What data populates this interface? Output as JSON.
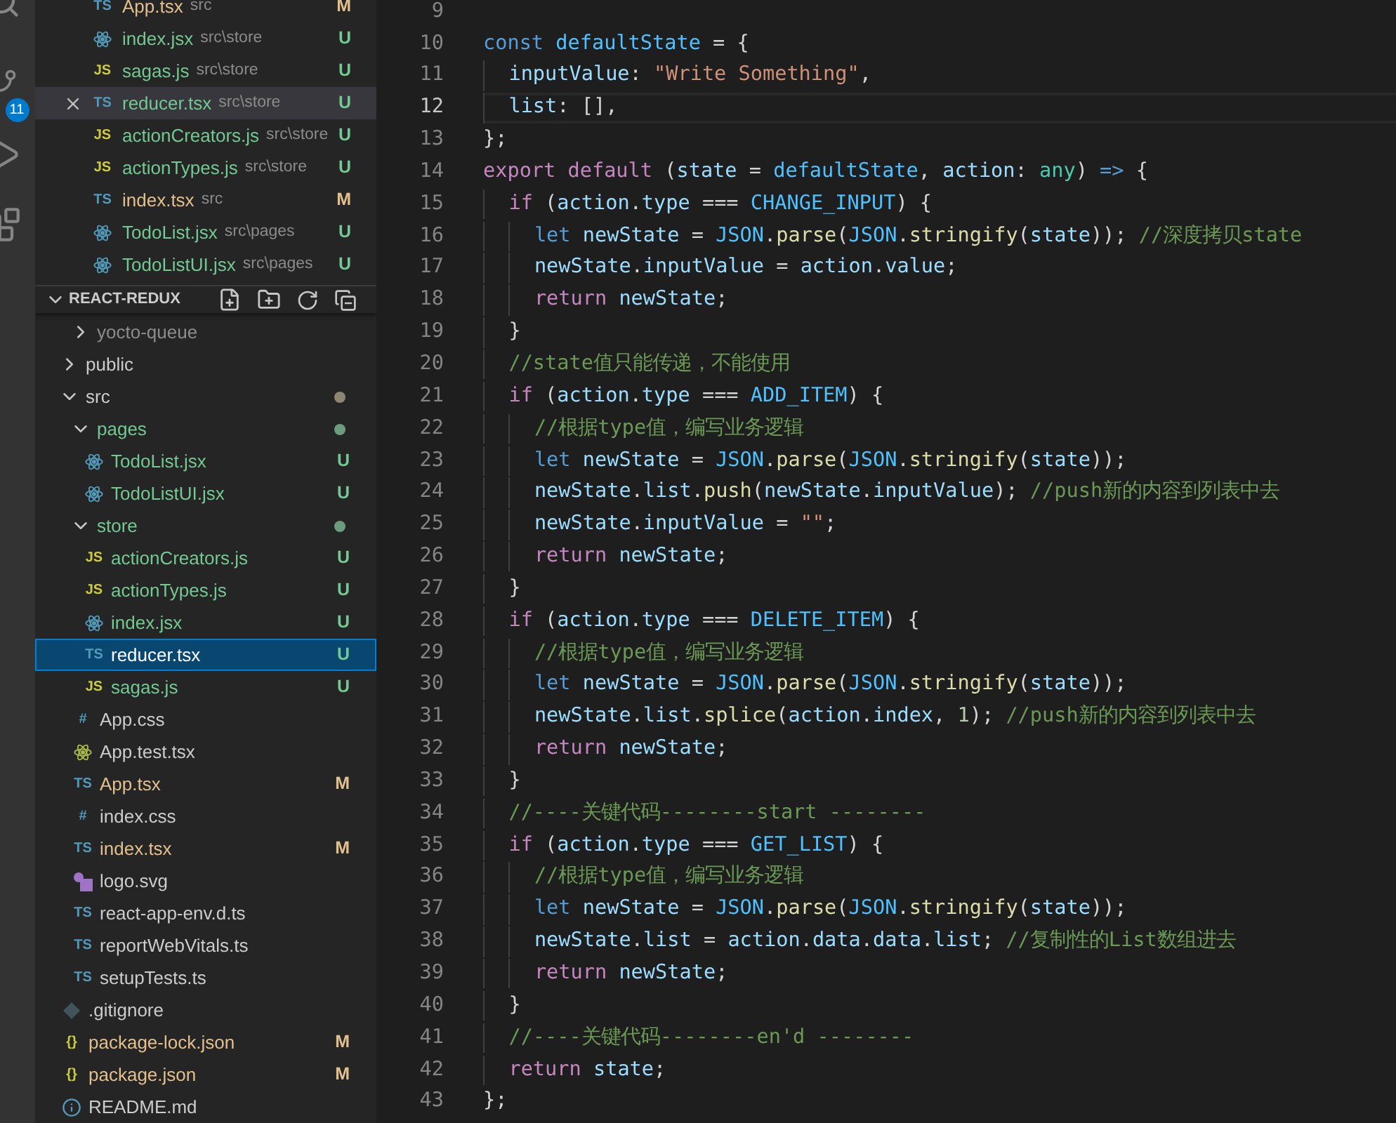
{
  "activity_bar": {
    "source_control_badge": "11"
  },
  "open_editors": [
    {
      "name": "App.tsx",
      "path": "src",
      "status": "M",
      "selected": false,
      "icon": {
        "kind": "glyph",
        "text": "TS",
        "color": "#519aba"
      }
    },
    {
      "name": "index.jsx",
      "path": "src\\store",
      "status": "U",
      "selected": false,
      "icon": {
        "kind": "react",
        "color": "#519aba"
      }
    },
    {
      "name": "sagas.js",
      "path": "src\\store",
      "status": "U",
      "selected": false,
      "icon": {
        "kind": "glyph",
        "text": "JS",
        "color": "#cbcb41"
      }
    },
    {
      "name": "reducer.tsx",
      "path": "src\\store",
      "status": "U",
      "selected": true,
      "icon": {
        "kind": "glyph",
        "text": "TS",
        "color": "#519aba"
      }
    },
    {
      "name": "actionCreators.js",
      "path": "src\\store",
      "status": "U",
      "selected": false,
      "icon": {
        "kind": "glyph",
        "text": "JS",
        "color": "#cbcb41"
      }
    },
    {
      "name": "actionTypes.js",
      "path": "src\\store",
      "status": "U",
      "selected": false,
      "icon": {
        "kind": "glyph",
        "text": "JS",
        "color": "#cbcb41"
      }
    },
    {
      "name": "index.tsx",
      "path": "src",
      "status": "M",
      "selected": false,
      "icon": {
        "kind": "glyph",
        "text": "TS",
        "color": "#519aba"
      }
    },
    {
      "name": "TodoList.jsx",
      "path": "src\\pages",
      "status": "U",
      "selected": false,
      "icon": {
        "kind": "react",
        "color": "#519aba"
      }
    },
    {
      "name": "TodoListUI.jsx",
      "path": "src\\pages",
      "status": "U",
      "selected": false,
      "icon": {
        "kind": "react",
        "color": "#519aba"
      }
    }
  ],
  "explorer": {
    "title": "REACT-REDUX",
    "expanded": true,
    "partial_above": [
      {
        "kind": "folder",
        "name": "yocto-queue",
        "expanded": false,
        "ignored": true,
        "has_changes": false
      }
    ],
    "tree": [
      {
        "kind": "folder",
        "name": "public",
        "expanded": false,
        "ignored": false,
        "untracked": false,
        "has_changes": false
      },
      {
        "kind": "folder",
        "name": "src",
        "expanded": true,
        "ignored": false,
        "untracked": false,
        "has_changes": true,
        "children": [
          {
            "kind": "folder",
            "name": "pages",
            "expanded": true,
            "ignored": false,
            "untracked": true,
            "has_changes": true,
            "children": [
              {
                "kind": "file",
                "name": "TodoList.jsx",
                "status": "U",
                "selected": false,
                "icon": {
                  "kind": "react",
                  "color": "#519aba"
                }
              },
              {
                "kind": "file",
                "name": "TodoListUI.jsx",
                "status": "U",
                "selected": false,
                "icon": {
                  "kind": "react",
                  "color": "#519aba"
                }
              }
            ]
          },
          {
            "kind": "folder",
            "name": "store",
            "expanded": true,
            "ignored": false,
            "untracked": true,
            "has_changes": true,
            "children": [
              {
                "kind": "file",
                "name": "actionCreators.js",
                "status": "U",
                "selected": false,
                "icon": {
                  "kind": "glyph",
                  "text": "JS",
                  "color": "#cbcb41"
                }
              },
              {
                "kind": "file",
                "name": "actionTypes.js",
                "status": "U",
                "selected": false,
                "icon": {
                  "kind": "glyph",
                  "text": "JS",
                  "color": "#cbcb41"
                }
              },
              {
                "kind": "file",
                "name": "index.jsx",
                "status": "U",
                "selected": false,
                "icon": {
                  "kind": "react",
                  "color": "#519aba"
                }
              },
              {
                "kind": "file",
                "name": "reducer.tsx",
                "status": "U",
                "selected": true,
                "icon": {
                  "kind": "glyph",
                  "text": "TS",
                  "color": "#519aba"
                }
              },
              {
                "kind": "file",
                "name": "sagas.js",
                "status": "U",
                "selected": false,
                "icon": {
                  "kind": "glyph",
                  "text": "JS",
                  "color": "#cbcb41"
                }
              }
            ]
          },
          {
            "kind": "file",
            "name": "App.css",
            "selected": false,
            "icon": {
              "kind": "glyph",
              "text": "#",
              "color": "#519aba"
            }
          },
          {
            "kind": "file",
            "name": "App.test.tsx",
            "selected": false,
            "icon": {
              "kind": "react",
              "color": "#a8b84a"
            }
          },
          {
            "kind": "file",
            "name": "App.tsx",
            "status": "M",
            "selected": false,
            "icon": {
              "kind": "glyph",
              "text": "TS",
              "color": "#519aba"
            }
          },
          {
            "kind": "file",
            "name": "index.css",
            "selected": false,
            "icon": {
              "kind": "glyph",
              "text": "#",
              "color": "#519aba"
            }
          },
          {
            "kind": "file",
            "name": "index.tsx",
            "status": "M",
            "selected": false,
            "icon": {
              "kind": "glyph",
              "text": "TS",
              "color": "#519aba"
            }
          },
          {
            "kind": "file",
            "name": "logo.svg",
            "selected": false,
            "icon": {
              "kind": "shapes",
              "color": "#a074c4"
            }
          },
          {
            "kind": "file",
            "name": "react-app-env.d.ts",
            "selected": false,
            "icon": {
              "kind": "glyph",
              "text": "TS",
              "color": "#519aba"
            }
          },
          {
            "kind": "file",
            "name": "reportWebVitals.ts",
            "selected": false,
            "icon": {
              "kind": "glyph",
              "text": "TS",
              "color": "#519aba"
            }
          },
          {
            "kind": "file",
            "name": "setupTests.ts",
            "selected": false,
            "icon": {
              "kind": "glyph",
              "text": "TS",
              "color": "#519aba"
            }
          }
        ]
      },
      {
        "kind": "file",
        "name": ".gitignore",
        "selected": false,
        "icon": {
          "kind": "diamond",
          "color": "#41535b"
        }
      },
      {
        "kind": "file",
        "name": "package-lock.json",
        "status": "M",
        "selected": false,
        "icon": {
          "kind": "glyph",
          "text": "{}",
          "color": "#cbcb41"
        }
      },
      {
        "kind": "file",
        "name": "package.json",
        "status": "M",
        "selected": false,
        "icon": {
          "kind": "glyph",
          "text": "{}",
          "color": "#cbcb41"
        }
      },
      {
        "kind": "file",
        "name": "README.md",
        "selected": false,
        "icon": {
          "kind": "info",
          "color": "#519aba"
        }
      }
    ]
  },
  "editor": {
    "lines": [
      {
        "number": "9",
        "current": false
      },
      {
        "number": "10",
        "current": false,
        "tokens": [
          {
            "kind": "kw",
            "text": "const "
          },
          {
            "kind": "const",
            "text": "defaultState"
          },
          {
            "kind": "p",
            "text": " = {"
          }
        ]
      },
      {
        "number": "11",
        "current": false,
        "tokens": [
          {
            "kind": "var",
            "text": "  inputValue"
          },
          {
            "kind": "p",
            "text": ": "
          },
          {
            "kind": "str",
            "text": "\"Write Something\""
          },
          {
            "kind": "p",
            "text": ","
          }
        ]
      },
      {
        "number": "12",
        "current": true,
        "tokens": [
          {
            "kind": "var",
            "text": "  list"
          },
          {
            "kind": "p",
            "text": ": [],"
          }
        ]
      },
      {
        "number": "13",
        "current": false,
        "tokens": [
          {
            "kind": "p",
            "text": "};"
          }
        ]
      },
      {
        "number": "14",
        "current": false,
        "tokens": [
          {
            "kind": "ctl",
            "text": "export default"
          },
          {
            "kind": "p",
            "text": " ("
          },
          {
            "kind": "var",
            "text": "state"
          },
          {
            "kind": "p",
            "text": " = "
          },
          {
            "kind": "const",
            "text": "defaultState"
          },
          {
            "kind": "p",
            "text": ", "
          },
          {
            "kind": "var",
            "text": "action"
          },
          {
            "kind": "p",
            "text": ": "
          },
          {
            "kind": "type",
            "text": "any"
          },
          {
            "kind": "p",
            "text": ") "
          },
          {
            "kind": "kw",
            "text": "=>"
          },
          {
            "kind": "p",
            "text": " {"
          }
        ]
      },
      {
        "number": "15",
        "current": false,
        "tokens": [
          {
            "kind": "ctl",
            "text": "  if"
          },
          {
            "kind": "p",
            "text": " ("
          },
          {
            "kind": "var",
            "text": "action"
          },
          {
            "kind": "p",
            "text": "."
          },
          {
            "kind": "var",
            "text": "type"
          },
          {
            "kind": "p",
            "text": " === "
          },
          {
            "kind": "const",
            "text": "CHANGE_INPUT"
          },
          {
            "kind": "p",
            "text": ") {"
          }
        ]
      },
      {
        "number": "16",
        "current": false,
        "tokens": [
          {
            "kind": "kw",
            "text": "    let "
          },
          {
            "kind": "var",
            "text": "newState"
          },
          {
            "kind": "p",
            "text": " = "
          },
          {
            "kind": "const",
            "text": "JSON"
          },
          {
            "kind": "p",
            "text": "."
          },
          {
            "kind": "fn",
            "text": "parse"
          },
          {
            "kind": "p",
            "text": "("
          },
          {
            "kind": "const",
            "text": "JSON"
          },
          {
            "kind": "p",
            "text": "."
          },
          {
            "kind": "fn",
            "text": "stringify"
          },
          {
            "kind": "p",
            "text": "("
          },
          {
            "kind": "var",
            "text": "state"
          },
          {
            "kind": "p",
            "text": ")); "
          },
          {
            "kind": "cmt",
            "text": "//深度拷贝state"
          }
        ]
      },
      {
        "number": "17",
        "current": false,
        "tokens": [
          {
            "kind": "var",
            "text": "    newState"
          },
          {
            "kind": "p",
            "text": "."
          },
          {
            "kind": "var",
            "text": "inputValue"
          },
          {
            "kind": "p",
            "text": " = "
          },
          {
            "kind": "var",
            "text": "action"
          },
          {
            "kind": "p",
            "text": "."
          },
          {
            "kind": "var",
            "text": "value"
          },
          {
            "kind": "p",
            "text": ";"
          }
        ]
      },
      {
        "number": "18",
        "current": false,
        "tokens": [
          {
            "kind": "ctl",
            "text": "    return "
          },
          {
            "kind": "var",
            "text": "newState"
          },
          {
            "kind": "p",
            "text": ";"
          }
        ]
      },
      {
        "number": "19",
        "current": false,
        "tokens": [
          {
            "kind": "p",
            "text": "  }"
          }
        ]
      },
      {
        "number": "20",
        "current": false,
        "tokens": [
          {
            "kind": "cmt",
            "text": "  //state值只能传递，不能使用"
          }
        ]
      },
      {
        "number": "21",
        "current": false,
        "tokens": [
          {
            "kind": "ctl",
            "text": "  if"
          },
          {
            "kind": "p",
            "text": " ("
          },
          {
            "kind": "var",
            "text": "action"
          },
          {
            "kind": "p",
            "text": "."
          },
          {
            "kind": "var",
            "text": "type"
          },
          {
            "kind": "p",
            "text": " === "
          },
          {
            "kind": "const",
            "text": "ADD_ITEM"
          },
          {
            "kind": "p",
            "text": ") {"
          }
        ]
      },
      {
        "number": "22",
        "current": false,
        "tokens": [
          {
            "kind": "cmt",
            "text": "    //根据type值，编写业务逻辑"
          }
        ]
      },
      {
        "number": "23",
        "current": false,
        "tokens": [
          {
            "kind": "kw",
            "text": "    let "
          },
          {
            "kind": "var",
            "text": "newState"
          },
          {
            "kind": "p",
            "text": " = "
          },
          {
            "kind": "const",
            "text": "JSON"
          },
          {
            "kind": "p",
            "text": "."
          },
          {
            "kind": "fn",
            "text": "parse"
          },
          {
            "kind": "p",
            "text": "("
          },
          {
            "kind": "const",
            "text": "JSON"
          },
          {
            "kind": "p",
            "text": "."
          },
          {
            "kind": "fn",
            "text": "stringify"
          },
          {
            "kind": "p",
            "text": "("
          },
          {
            "kind": "var",
            "text": "state"
          },
          {
            "kind": "p",
            "text": "));"
          }
        ]
      },
      {
        "number": "24",
        "current": false,
        "tokens": [
          {
            "kind": "var",
            "text": "    newState"
          },
          {
            "kind": "p",
            "text": "."
          },
          {
            "kind": "var",
            "text": "list"
          },
          {
            "kind": "p",
            "text": "."
          },
          {
            "kind": "fn",
            "text": "push"
          },
          {
            "kind": "p",
            "text": "("
          },
          {
            "kind": "var",
            "text": "newState"
          },
          {
            "kind": "p",
            "text": "."
          },
          {
            "kind": "var",
            "text": "inputValue"
          },
          {
            "kind": "p",
            "text": "); "
          },
          {
            "kind": "cmt",
            "text": "//push新的内容到列表中去"
          }
        ]
      },
      {
        "number": "25",
        "current": false,
        "tokens": [
          {
            "kind": "var",
            "text": "    newState"
          },
          {
            "kind": "p",
            "text": "."
          },
          {
            "kind": "var",
            "text": "inputValue"
          },
          {
            "kind": "p",
            "text": " = "
          },
          {
            "kind": "str",
            "text": "\"\""
          },
          {
            "kind": "p",
            "text": ";"
          }
        ]
      },
      {
        "number": "26",
        "current": false,
        "tokens": [
          {
            "kind": "ctl",
            "text": "    return "
          },
          {
            "kind": "var",
            "text": "newState"
          },
          {
            "kind": "p",
            "text": ";"
          }
        ]
      },
      {
        "number": "27",
        "current": false,
        "tokens": [
          {
            "kind": "p",
            "text": "  }"
          }
        ]
      },
      {
        "number": "28",
        "current": false,
        "tokens": [
          {
            "kind": "ctl",
            "text": "  if"
          },
          {
            "kind": "p",
            "text": " ("
          },
          {
            "kind": "var",
            "text": "action"
          },
          {
            "kind": "p",
            "text": "."
          },
          {
            "kind": "var",
            "text": "type"
          },
          {
            "kind": "p",
            "text": " === "
          },
          {
            "kind": "const",
            "text": "DELETE_ITEM"
          },
          {
            "kind": "p",
            "text": ") {"
          }
        ]
      },
      {
        "number": "29",
        "current": false,
        "tokens": [
          {
            "kind": "cmt",
            "text": "    //根据type值，编写业务逻辑"
          }
        ]
      },
      {
        "number": "30",
        "current": false,
        "tokens": [
          {
            "kind": "kw",
            "text": "    let "
          },
          {
            "kind": "var",
            "text": "newState"
          },
          {
            "kind": "p",
            "text": " = "
          },
          {
            "kind": "const",
            "text": "JSON"
          },
          {
            "kind": "p",
            "text": "."
          },
          {
            "kind": "fn",
            "text": "parse"
          },
          {
            "kind": "p",
            "text": "("
          },
          {
            "kind": "const",
            "text": "JSON"
          },
          {
            "kind": "p",
            "text": "."
          },
          {
            "kind": "fn",
            "text": "stringify"
          },
          {
            "kind": "p",
            "text": "("
          },
          {
            "kind": "var",
            "text": "state"
          },
          {
            "kind": "p",
            "text": "));"
          }
        ]
      },
      {
        "number": "31",
        "current": false,
        "tokens": [
          {
            "kind": "var",
            "text": "    newState"
          },
          {
            "kind": "p",
            "text": "."
          },
          {
            "kind": "var",
            "text": "list"
          },
          {
            "kind": "p",
            "text": "."
          },
          {
            "kind": "fn",
            "text": "splice"
          },
          {
            "kind": "p",
            "text": "("
          },
          {
            "kind": "var",
            "text": "action"
          },
          {
            "kind": "p",
            "text": "."
          },
          {
            "kind": "var",
            "text": "index"
          },
          {
            "kind": "p",
            "text": ", "
          },
          {
            "kind": "num",
            "text": "1"
          },
          {
            "kind": "p",
            "text": "); "
          },
          {
            "kind": "cmt",
            "text": "//push新的内容到列表中去"
          }
        ]
      },
      {
        "number": "32",
        "current": false,
        "tokens": [
          {
            "kind": "ctl",
            "text": "    return "
          },
          {
            "kind": "var",
            "text": "newState"
          },
          {
            "kind": "p",
            "text": ";"
          }
        ]
      },
      {
        "number": "33",
        "current": false,
        "tokens": [
          {
            "kind": "p",
            "text": "  }"
          }
        ]
      },
      {
        "number": "34",
        "current": false,
        "tokens": [
          {
            "kind": "cmt",
            "text": "  //----关键代码--------start --------"
          }
        ]
      },
      {
        "number": "35",
        "current": false,
        "tokens": [
          {
            "kind": "ctl",
            "text": "  if"
          },
          {
            "kind": "p",
            "text": " ("
          },
          {
            "kind": "var",
            "text": "action"
          },
          {
            "kind": "p",
            "text": "."
          },
          {
            "kind": "var",
            "text": "type"
          },
          {
            "kind": "p",
            "text": " === "
          },
          {
            "kind": "const",
            "text": "GET_LIST"
          },
          {
            "kind": "p",
            "text": ") {"
          }
        ]
      },
      {
        "number": "36",
        "current": false,
        "tokens": [
          {
            "kind": "cmt",
            "text": "    //根据type值，编写业务逻辑"
          }
        ]
      },
      {
        "number": "37",
        "current": false,
        "tokens": [
          {
            "kind": "kw",
            "text": "    let "
          },
          {
            "kind": "var",
            "text": "newState"
          },
          {
            "kind": "p",
            "text": " = "
          },
          {
            "kind": "const",
            "text": "JSON"
          },
          {
            "kind": "p",
            "text": "."
          },
          {
            "kind": "fn",
            "text": "parse"
          },
          {
            "kind": "p",
            "text": "("
          },
          {
            "kind": "const",
            "text": "JSON"
          },
          {
            "kind": "p",
            "text": "."
          },
          {
            "kind": "fn",
            "text": "stringify"
          },
          {
            "kind": "p",
            "text": "("
          },
          {
            "kind": "var",
            "text": "state"
          },
          {
            "kind": "p",
            "text": "));"
          }
        ]
      },
      {
        "number": "38",
        "current": false,
        "tokens": [
          {
            "kind": "var",
            "text": "    newState"
          },
          {
            "kind": "p",
            "text": "."
          },
          {
            "kind": "var",
            "text": "list"
          },
          {
            "kind": "p",
            "text": " = "
          },
          {
            "kind": "var",
            "text": "action"
          },
          {
            "kind": "p",
            "text": "."
          },
          {
            "kind": "var",
            "text": "data"
          },
          {
            "kind": "p",
            "text": "."
          },
          {
            "kind": "var",
            "text": "data"
          },
          {
            "kind": "p",
            "text": "."
          },
          {
            "kind": "var",
            "text": "list"
          },
          {
            "kind": "p",
            "text": "; "
          },
          {
            "kind": "cmt",
            "text": "//复制性的List数组进去"
          }
        ]
      },
      {
        "number": "39",
        "current": false,
        "tokens": [
          {
            "kind": "ctl",
            "text": "    return "
          },
          {
            "kind": "var",
            "text": "newState"
          },
          {
            "kind": "p",
            "text": ";"
          }
        ]
      },
      {
        "number": "40",
        "current": false,
        "tokens": [
          {
            "kind": "p",
            "text": "  }"
          }
        ]
      },
      {
        "number": "41",
        "current": false,
        "tokens": [
          {
            "kind": "cmt",
            "text": "  //----关键代码--------en'd --------"
          }
        ]
      },
      {
        "number": "42",
        "current": false,
        "tokens": [
          {
            "kind": "ctl",
            "text": "  return "
          },
          {
            "kind": "var",
            "text": "state"
          },
          {
            "kind": "p",
            "text": ";"
          }
        ]
      },
      {
        "number": "43",
        "current": false,
        "tokens": [
          {
            "kind": "p",
            "text": "};"
          }
        ]
      }
    ]
  }
}
